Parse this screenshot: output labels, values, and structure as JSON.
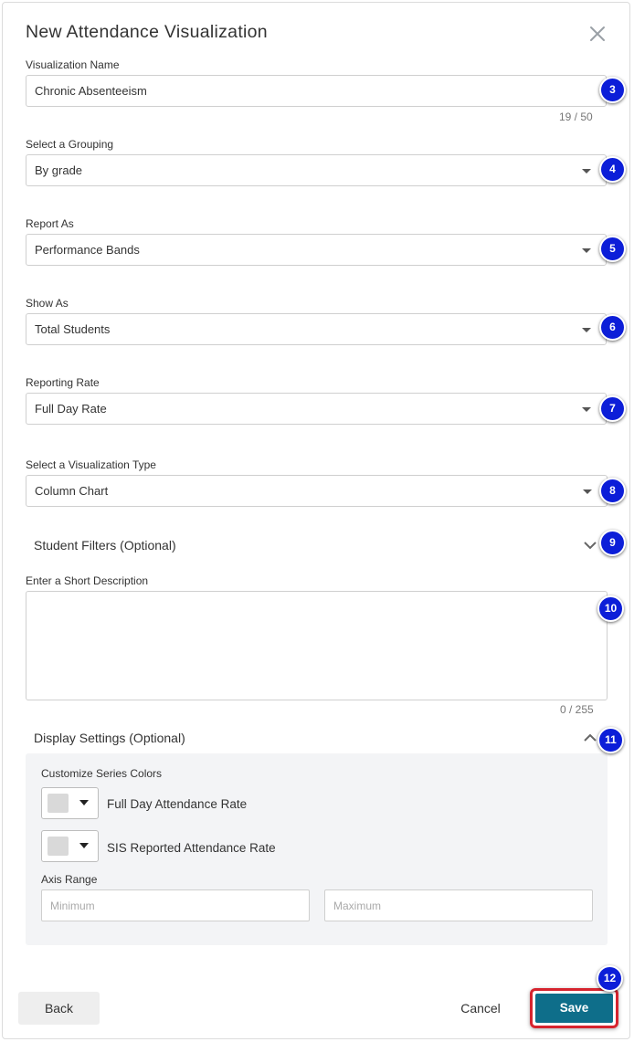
{
  "dialog": {
    "title": "New Attendance Visualization"
  },
  "visualization_name": {
    "label": "Visualization Name",
    "value": "Chronic Absenteeism",
    "counter": "19 / 50"
  },
  "grouping": {
    "label": "Select a Grouping",
    "value": "By grade"
  },
  "report_as": {
    "label": "Report As",
    "value": "Performance Bands"
  },
  "show_as": {
    "label": "Show As",
    "value": "Total Students"
  },
  "reporting_rate": {
    "label": "Reporting Rate",
    "value": "Full Day Rate"
  },
  "visualization_type": {
    "label": "Select a Visualization Type",
    "value": "Column Chart"
  },
  "student_filters": {
    "label": "Student Filters (Optional)"
  },
  "description": {
    "label": "Enter a Short Description",
    "value": "",
    "counter": "0 / 255"
  },
  "display_settings": {
    "label": "Display Settings (Optional)",
    "series_colors_label": "Customize Series Colors",
    "series": [
      {
        "name": "Full Day Attendance Rate",
        "color": "#d9d9d9"
      },
      {
        "name": "SIS Reported Attendance Rate",
        "color": "#d9d9d9"
      }
    ],
    "axis_range_label": "Axis Range",
    "min_placeholder": "Minimum",
    "max_placeholder": "Maximum"
  },
  "footer": {
    "back_label": "Back",
    "cancel_label": "Cancel",
    "save_label": "Save"
  },
  "callouts": [
    "3",
    "4",
    "5",
    "6",
    "7",
    "8",
    "9",
    "10",
    "11",
    "12"
  ],
  "colors": {
    "primary": "#0e6e8a",
    "callout": "#0c1ed8",
    "highlight": "#d6242e"
  }
}
